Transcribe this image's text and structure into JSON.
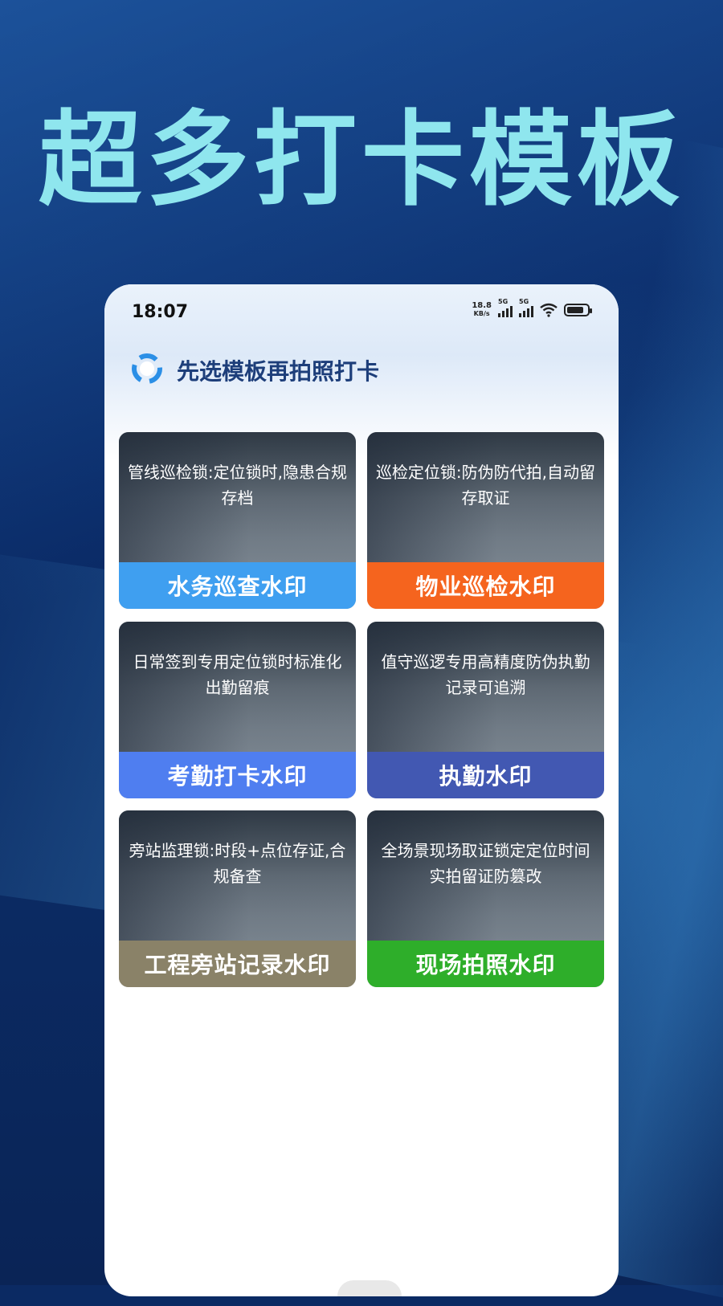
{
  "headline": "超多打卡模板",
  "status_bar": {
    "time": "18:07",
    "net_speed_value": "18.8",
    "net_speed_unit": "KB/s",
    "signal1_label": "5G",
    "signal2_label": "5G"
  },
  "app": {
    "title": "先选模板再拍照打卡",
    "logo_icon": "refresh-circle-icon"
  },
  "templates": [
    {
      "desc": "管线巡检锁:定位锁时,隐患合规存档",
      "label": "水务巡查水印",
      "color": "#3f9ff0"
    },
    {
      "desc": "巡检定位锁:防伪防代拍,自动留存取证",
      "label": "物业巡检水印",
      "color": "#f5641e"
    },
    {
      "desc": "日常签到专用定位锁时标准化出勤留痕",
      "label": "考勤打卡水印",
      "color": "#4f7ef0"
    },
    {
      "desc": "值守巡逻专用高精度防伪执勤记录可追溯",
      "label": "执勤水印",
      "color": "#4258b2"
    },
    {
      "desc": "旁站监理锁:时段+点位存证,合规备查",
      "label": "工程旁站记录水印",
      "color": "#8a8268"
    },
    {
      "desc": "全场景现场取证锁定定位时间实拍留证防篡改",
      "label": "现场拍照水印",
      "color": "#2eae2a"
    }
  ]
}
